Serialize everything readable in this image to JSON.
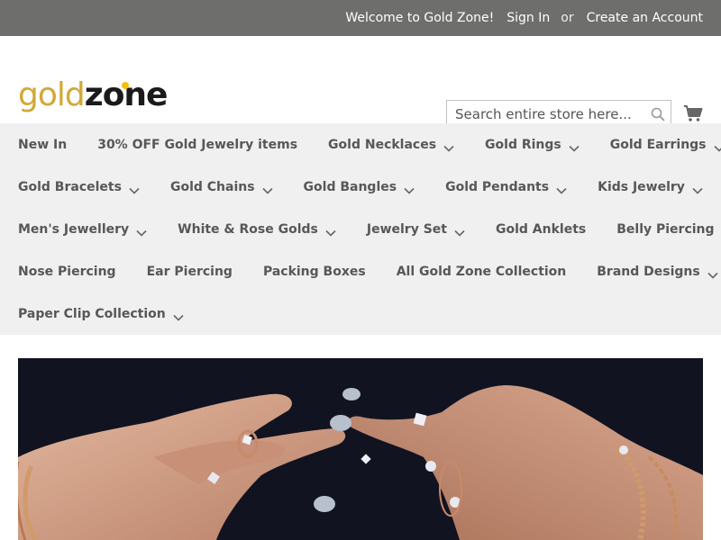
{
  "topbar": {
    "welcome": "Welcome to Gold Zone!",
    "sign_in": "Sign In",
    "or": "or",
    "create_account": "Create an Account"
  },
  "header": {
    "logo_gold": "gold",
    "logo_zone": "zone",
    "search_placeholder": "Search entire store here...",
    "search_icon": "magnifier-icon",
    "cart_icon": "shopping-cart-icon"
  },
  "nav": {
    "rows": [
      [
        {
          "label": "New In",
          "dropdown": false
        },
        {
          "label": "30% OFF Gold Jewelry items",
          "dropdown": false
        },
        {
          "label": "Gold Necklaces",
          "dropdown": true
        },
        {
          "label": "Gold Rings",
          "dropdown": true
        },
        {
          "label": "Gold Earrings",
          "dropdown": true
        }
      ],
      [
        {
          "label": "Gold Bracelets",
          "dropdown": true
        },
        {
          "label": "Gold Chains",
          "dropdown": true
        },
        {
          "label": "Gold Bangles",
          "dropdown": true
        },
        {
          "label": "Gold Pendants",
          "dropdown": true
        },
        {
          "label": "Kids Jewelry",
          "dropdown": true
        }
      ],
      [
        {
          "label": "Men's Jewellery",
          "dropdown": true
        },
        {
          "label": "White & Rose Golds",
          "dropdown": true
        },
        {
          "label": "Jewelry Set",
          "dropdown": true
        },
        {
          "label": "Gold Anklets",
          "dropdown": false
        },
        {
          "label": "Belly Piercing",
          "dropdown": false
        }
      ],
      [
        {
          "label": "Nose Piercing",
          "dropdown": false
        },
        {
          "label": "Ear Piercing",
          "dropdown": false
        },
        {
          "label": "Packing Boxes",
          "dropdown": false
        },
        {
          "label": "All Gold Zone Collection",
          "dropdown": false
        },
        {
          "label": "Brand Designs",
          "dropdown": true
        }
      ],
      [
        {
          "label": "Paper Clip Collection",
          "dropdown": true
        }
      ]
    ]
  },
  "colors": {
    "topbar_bg": "#6e6e6c",
    "logo_gold": "#d2a837",
    "nav_bg": "#f0f0f0",
    "nav_text": "#575757",
    "hero_bg": "#111321"
  }
}
